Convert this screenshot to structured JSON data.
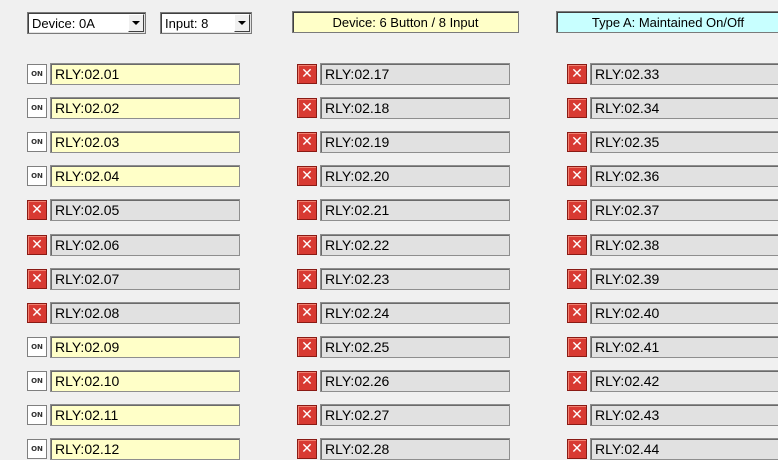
{
  "toolbar": {
    "device_select": {
      "value": "Device: 0A"
    },
    "input_select": {
      "value": "Input: 8"
    },
    "device_info": "Device: 6 Button / 8 Input",
    "type_info": "Type A: Maintained On/Off"
  },
  "colors": {
    "device_info_bg": "#ffffc8",
    "type_info_bg": "#c8ffff",
    "on_label_bg": "#ffffc8",
    "off_label_bg": "#e1e1e1",
    "off_icon": "#d83a32"
  },
  "toggle_text_on": "ON",
  "toggle_text_off": "✕",
  "columns": [
    [
      {
        "label": "RLY:02.01",
        "state": "on"
      },
      {
        "label": "RLY:02.02",
        "state": "on"
      },
      {
        "label": "RLY:02.03",
        "state": "on"
      },
      {
        "label": "RLY:02.04",
        "state": "on"
      },
      {
        "label": "RLY:02.05",
        "state": "off"
      },
      {
        "label": "RLY:02.06",
        "state": "off"
      },
      {
        "label": "RLY:02.07",
        "state": "off"
      },
      {
        "label": "RLY:02.08",
        "state": "off"
      },
      {
        "label": "RLY:02.09",
        "state": "on"
      },
      {
        "label": "RLY:02.10",
        "state": "on"
      },
      {
        "label": "RLY:02.11",
        "state": "on"
      },
      {
        "label": "RLY:02.12",
        "state": "on"
      }
    ],
    [
      {
        "label": "RLY:02.17",
        "state": "off"
      },
      {
        "label": "RLY:02.18",
        "state": "off"
      },
      {
        "label": "RLY:02.19",
        "state": "off"
      },
      {
        "label": "RLY:02.20",
        "state": "off"
      },
      {
        "label": "RLY:02.21",
        "state": "off"
      },
      {
        "label": "RLY:02.22",
        "state": "off"
      },
      {
        "label": "RLY:02.23",
        "state": "off"
      },
      {
        "label": "RLY:02.24",
        "state": "off"
      },
      {
        "label": "RLY:02.25",
        "state": "off"
      },
      {
        "label": "RLY:02.26",
        "state": "off"
      },
      {
        "label": "RLY:02.27",
        "state": "off"
      },
      {
        "label": "RLY:02.28",
        "state": "off"
      }
    ],
    [
      {
        "label": "RLY:02.33",
        "state": "off"
      },
      {
        "label": "RLY:02.34",
        "state": "off"
      },
      {
        "label": "RLY:02.35",
        "state": "off"
      },
      {
        "label": "RLY:02.36",
        "state": "off"
      },
      {
        "label": "RLY:02.37",
        "state": "off"
      },
      {
        "label": "RLY:02.38",
        "state": "off"
      },
      {
        "label": "RLY:02.39",
        "state": "off"
      },
      {
        "label": "RLY:02.40",
        "state": "off"
      },
      {
        "label": "RLY:02.41",
        "state": "off"
      },
      {
        "label": "RLY:02.42",
        "state": "off"
      },
      {
        "label": "RLY:02.43",
        "state": "off"
      },
      {
        "label": "RLY:02.44",
        "state": "off"
      }
    ]
  ]
}
